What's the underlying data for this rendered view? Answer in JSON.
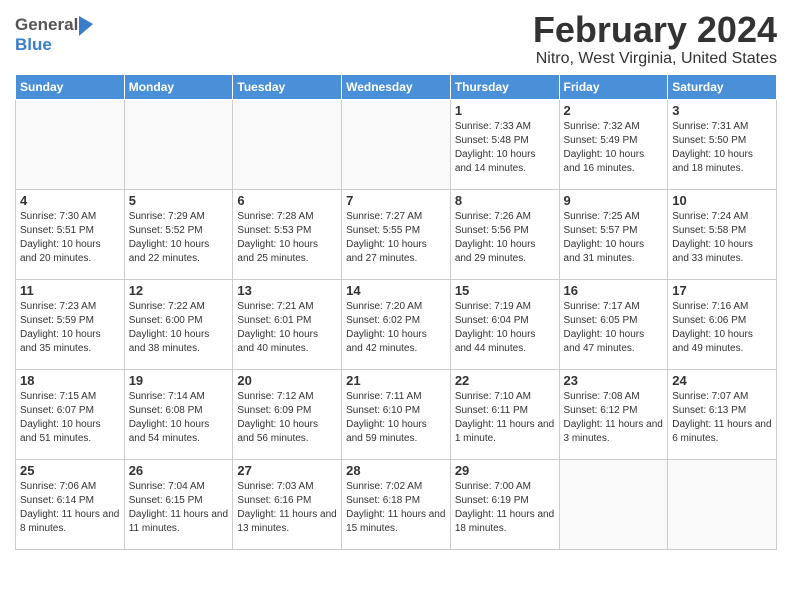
{
  "header": {
    "logo_general": "General",
    "logo_blue": "Blue",
    "month_title": "February 2024",
    "location": "Nitro, West Virginia, United States"
  },
  "weekdays": [
    "Sunday",
    "Monday",
    "Tuesday",
    "Wednesday",
    "Thursday",
    "Friday",
    "Saturday"
  ],
  "weeks": [
    [
      {
        "day": "",
        "info": ""
      },
      {
        "day": "",
        "info": ""
      },
      {
        "day": "",
        "info": ""
      },
      {
        "day": "",
        "info": ""
      },
      {
        "day": "1",
        "info": "Sunrise: 7:33 AM\nSunset: 5:48 PM\nDaylight: 10 hours\nand 14 minutes."
      },
      {
        "day": "2",
        "info": "Sunrise: 7:32 AM\nSunset: 5:49 PM\nDaylight: 10 hours\nand 16 minutes."
      },
      {
        "day": "3",
        "info": "Sunrise: 7:31 AM\nSunset: 5:50 PM\nDaylight: 10 hours\nand 18 minutes."
      }
    ],
    [
      {
        "day": "4",
        "info": "Sunrise: 7:30 AM\nSunset: 5:51 PM\nDaylight: 10 hours\nand 20 minutes."
      },
      {
        "day": "5",
        "info": "Sunrise: 7:29 AM\nSunset: 5:52 PM\nDaylight: 10 hours\nand 22 minutes."
      },
      {
        "day": "6",
        "info": "Sunrise: 7:28 AM\nSunset: 5:53 PM\nDaylight: 10 hours\nand 25 minutes."
      },
      {
        "day": "7",
        "info": "Sunrise: 7:27 AM\nSunset: 5:55 PM\nDaylight: 10 hours\nand 27 minutes."
      },
      {
        "day": "8",
        "info": "Sunrise: 7:26 AM\nSunset: 5:56 PM\nDaylight: 10 hours\nand 29 minutes."
      },
      {
        "day": "9",
        "info": "Sunrise: 7:25 AM\nSunset: 5:57 PM\nDaylight: 10 hours\nand 31 minutes."
      },
      {
        "day": "10",
        "info": "Sunrise: 7:24 AM\nSunset: 5:58 PM\nDaylight: 10 hours\nand 33 minutes."
      }
    ],
    [
      {
        "day": "11",
        "info": "Sunrise: 7:23 AM\nSunset: 5:59 PM\nDaylight: 10 hours\nand 35 minutes."
      },
      {
        "day": "12",
        "info": "Sunrise: 7:22 AM\nSunset: 6:00 PM\nDaylight: 10 hours\nand 38 minutes."
      },
      {
        "day": "13",
        "info": "Sunrise: 7:21 AM\nSunset: 6:01 PM\nDaylight: 10 hours\nand 40 minutes."
      },
      {
        "day": "14",
        "info": "Sunrise: 7:20 AM\nSunset: 6:02 PM\nDaylight: 10 hours\nand 42 minutes."
      },
      {
        "day": "15",
        "info": "Sunrise: 7:19 AM\nSunset: 6:04 PM\nDaylight: 10 hours\nand 44 minutes."
      },
      {
        "day": "16",
        "info": "Sunrise: 7:17 AM\nSunset: 6:05 PM\nDaylight: 10 hours\nand 47 minutes."
      },
      {
        "day": "17",
        "info": "Sunrise: 7:16 AM\nSunset: 6:06 PM\nDaylight: 10 hours\nand 49 minutes."
      }
    ],
    [
      {
        "day": "18",
        "info": "Sunrise: 7:15 AM\nSunset: 6:07 PM\nDaylight: 10 hours\nand 51 minutes."
      },
      {
        "day": "19",
        "info": "Sunrise: 7:14 AM\nSunset: 6:08 PM\nDaylight: 10 hours\nand 54 minutes."
      },
      {
        "day": "20",
        "info": "Sunrise: 7:12 AM\nSunset: 6:09 PM\nDaylight: 10 hours\nand 56 minutes."
      },
      {
        "day": "21",
        "info": "Sunrise: 7:11 AM\nSunset: 6:10 PM\nDaylight: 10 hours\nand 59 minutes."
      },
      {
        "day": "22",
        "info": "Sunrise: 7:10 AM\nSunset: 6:11 PM\nDaylight: 11 hours\nand 1 minute."
      },
      {
        "day": "23",
        "info": "Sunrise: 7:08 AM\nSunset: 6:12 PM\nDaylight: 11 hours\nand 3 minutes."
      },
      {
        "day": "24",
        "info": "Sunrise: 7:07 AM\nSunset: 6:13 PM\nDaylight: 11 hours\nand 6 minutes."
      }
    ],
    [
      {
        "day": "25",
        "info": "Sunrise: 7:06 AM\nSunset: 6:14 PM\nDaylight: 11 hours\nand 8 minutes."
      },
      {
        "day": "26",
        "info": "Sunrise: 7:04 AM\nSunset: 6:15 PM\nDaylight: 11 hours\nand 11 minutes."
      },
      {
        "day": "27",
        "info": "Sunrise: 7:03 AM\nSunset: 6:16 PM\nDaylight: 11 hours\nand 13 minutes."
      },
      {
        "day": "28",
        "info": "Sunrise: 7:02 AM\nSunset: 6:18 PM\nDaylight: 11 hours\nand 15 minutes."
      },
      {
        "day": "29",
        "info": "Sunrise: 7:00 AM\nSunset: 6:19 PM\nDaylight: 11 hours\nand 18 minutes."
      },
      {
        "day": "",
        "info": ""
      },
      {
        "day": "",
        "info": ""
      }
    ]
  ]
}
